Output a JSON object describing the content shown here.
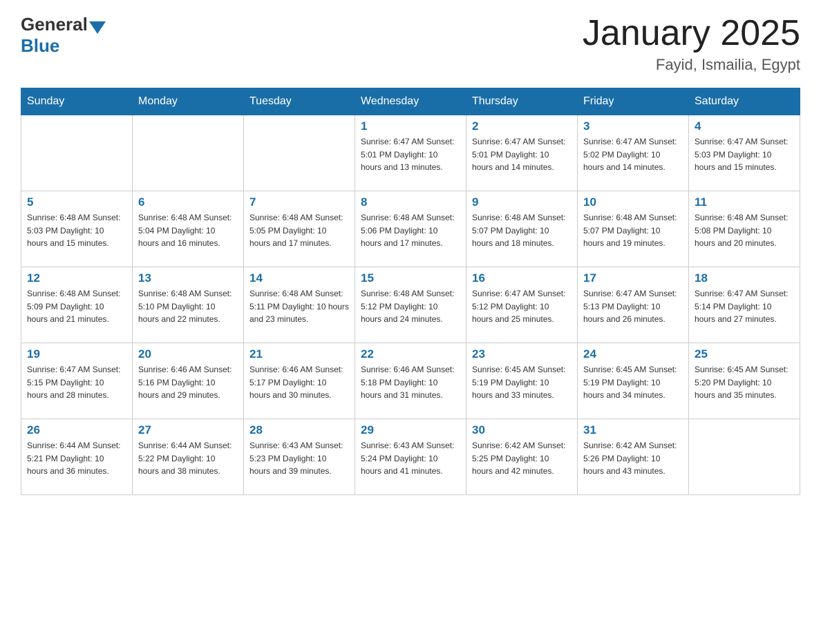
{
  "header": {
    "logo_general": "General",
    "logo_blue": "Blue",
    "title": "January 2025",
    "subtitle": "Fayid, Ismailia, Egypt"
  },
  "days_of_week": [
    "Sunday",
    "Monday",
    "Tuesday",
    "Wednesday",
    "Thursday",
    "Friday",
    "Saturday"
  ],
  "weeks": [
    [
      {
        "day": "",
        "info": ""
      },
      {
        "day": "",
        "info": ""
      },
      {
        "day": "",
        "info": ""
      },
      {
        "day": "1",
        "info": "Sunrise: 6:47 AM\nSunset: 5:01 PM\nDaylight: 10 hours\nand 13 minutes."
      },
      {
        "day": "2",
        "info": "Sunrise: 6:47 AM\nSunset: 5:01 PM\nDaylight: 10 hours\nand 14 minutes."
      },
      {
        "day": "3",
        "info": "Sunrise: 6:47 AM\nSunset: 5:02 PM\nDaylight: 10 hours\nand 14 minutes."
      },
      {
        "day": "4",
        "info": "Sunrise: 6:47 AM\nSunset: 5:03 PM\nDaylight: 10 hours\nand 15 minutes."
      }
    ],
    [
      {
        "day": "5",
        "info": "Sunrise: 6:48 AM\nSunset: 5:03 PM\nDaylight: 10 hours\nand 15 minutes."
      },
      {
        "day": "6",
        "info": "Sunrise: 6:48 AM\nSunset: 5:04 PM\nDaylight: 10 hours\nand 16 minutes."
      },
      {
        "day": "7",
        "info": "Sunrise: 6:48 AM\nSunset: 5:05 PM\nDaylight: 10 hours\nand 17 minutes."
      },
      {
        "day": "8",
        "info": "Sunrise: 6:48 AM\nSunset: 5:06 PM\nDaylight: 10 hours\nand 17 minutes."
      },
      {
        "day": "9",
        "info": "Sunrise: 6:48 AM\nSunset: 5:07 PM\nDaylight: 10 hours\nand 18 minutes."
      },
      {
        "day": "10",
        "info": "Sunrise: 6:48 AM\nSunset: 5:07 PM\nDaylight: 10 hours\nand 19 minutes."
      },
      {
        "day": "11",
        "info": "Sunrise: 6:48 AM\nSunset: 5:08 PM\nDaylight: 10 hours\nand 20 minutes."
      }
    ],
    [
      {
        "day": "12",
        "info": "Sunrise: 6:48 AM\nSunset: 5:09 PM\nDaylight: 10 hours\nand 21 minutes."
      },
      {
        "day": "13",
        "info": "Sunrise: 6:48 AM\nSunset: 5:10 PM\nDaylight: 10 hours\nand 22 minutes."
      },
      {
        "day": "14",
        "info": "Sunrise: 6:48 AM\nSunset: 5:11 PM\nDaylight: 10 hours\nand 23 minutes."
      },
      {
        "day": "15",
        "info": "Sunrise: 6:48 AM\nSunset: 5:12 PM\nDaylight: 10 hours\nand 24 minutes."
      },
      {
        "day": "16",
        "info": "Sunrise: 6:47 AM\nSunset: 5:12 PM\nDaylight: 10 hours\nand 25 minutes."
      },
      {
        "day": "17",
        "info": "Sunrise: 6:47 AM\nSunset: 5:13 PM\nDaylight: 10 hours\nand 26 minutes."
      },
      {
        "day": "18",
        "info": "Sunrise: 6:47 AM\nSunset: 5:14 PM\nDaylight: 10 hours\nand 27 minutes."
      }
    ],
    [
      {
        "day": "19",
        "info": "Sunrise: 6:47 AM\nSunset: 5:15 PM\nDaylight: 10 hours\nand 28 minutes."
      },
      {
        "day": "20",
        "info": "Sunrise: 6:46 AM\nSunset: 5:16 PM\nDaylight: 10 hours\nand 29 minutes."
      },
      {
        "day": "21",
        "info": "Sunrise: 6:46 AM\nSunset: 5:17 PM\nDaylight: 10 hours\nand 30 minutes."
      },
      {
        "day": "22",
        "info": "Sunrise: 6:46 AM\nSunset: 5:18 PM\nDaylight: 10 hours\nand 31 minutes."
      },
      {
        "day": "23",
        "info": "Sunrise: 6:45 AM\nSunset: 5:19 PM\nDaylight: 10 hours\nand 33 minutes."
      },
      {
        "day": "24",
        "info": "Sunrise: 6:45 AM\nSunset: 5:19 PM\nDaylight: 10 hours\nand 34 minutes."
      },
      {
        "day": "25",
        "info": "Sunrise: 6:45 AM\nSunset: 5:20 PM\nDaylight: 10 hours\nand 35 minutes."
      }
    ],
    [
      {
        "day": "26",
        "info": "Sunrise: 6:44 AM\nSunset: 5:21 PM\nDaylight: 10 hours\nand 36 minutes."
      },
      {
        "day": "27",
        "info": "Sunrise: 6:44 AM\nSunset: 5:22 PM\nDaylight: 10 hours\nand 38 minutes."
      },
      {
        "day": "28",
        "info": "Sunrise: 6:43 AM\nSunset: 5:23 PM\nDaylight: 10 hours\nand 39 minutes."
      },
      {
        "day": "29",
        "info": "Sunrise: 6:43 AM\nSunset: 5:24 PM\nDaylight: 10 hours\nand 41 minutes."
      },
      {
        "day": "30",
        "info": "Sunrise: 6:42 AM\nSunset: 5:25 PM\nDaylight: 10 hours\nand 42 minutes."
      },
      {
        "day": "31",
        "info": "Sunrise: 6:42 AM\nSunset: 5:26 PM\nDaylight: 10 hours\nand 43 minutes."
      },
      {
        "day": "",
        "info": ""
      }
    ]
  ]
}
